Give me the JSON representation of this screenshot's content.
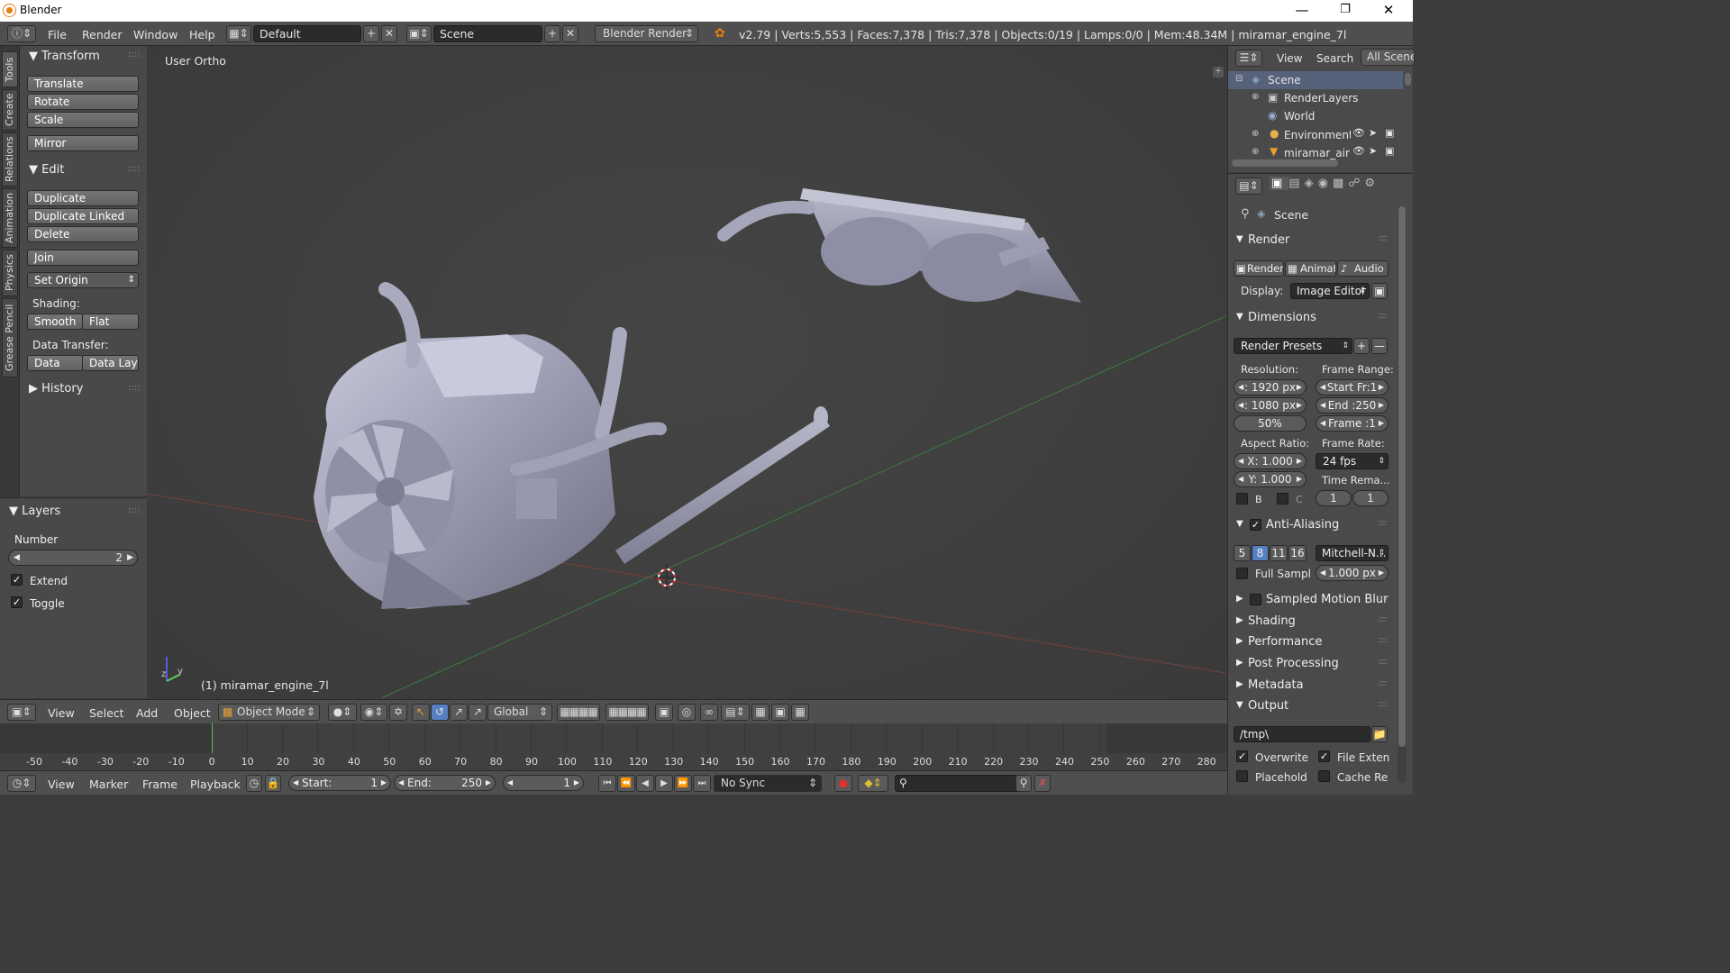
{
  "window": {
    "title": "Blender"
  },
  "info_bar": {
    "menus": [
      "File",
      "Render",
      "Window",
      "Help"
    ],
    "layout": "Default",
    "scene": "Scene",
    "engine": "Blender Render",
    "stats": "v2.79 | Verts:5,553 | Faces:7,378 | Tris:7,378 | Objects:0/19 | Lamps:0/0 | Mem:48.34M | miramar_engine_7l"
  },
  "tool_tabs": [
    "Tools",
    "Create",
    "Relations",
    "Animation",
    "Physics",
    "Grease Pencil"
  ],
  "tools": {
    "transform_header": "Transform",
    "translate": "Translate",
    "rotate": "Rotate",
    "scale": "Scale",
    "mirror": "Mirror",
    "edit_header": "Edit",
    "duplicate": "Duplicate",
    "duplicate_linked": "Duplicate Linked",
    "delete": "Delete",
    "join": "Join",
    "set_origin": "Set Origin",
    "shading_label": "Shading:",
    "smooth": "Smooth",
    "flat": "Flat",
    "data_transfer_label": "Data Transfer:",
    "data": "Data",
    "data_lay": "Data Lay",
    "history_header": "History"
  },
  "layers_panel": {
    "header": "Layers",
    "number_label": "Number",
    "number_value": "2",
    "extend": "Extend",
    "toggle": "Toggle"
  },
  "viewport": {
    "view_name": "User Ortho",
    "object_label": "(1) miramar_engine_7l"
  },
  "outliner": {
    "view": "View",
    "search": "Search",
    "filter": "All Scenes",
    "items": [
      "Scene",
      "RenderLayers",
      "World",
      "Environment",
      "miramar_air"
    ]
  },
  "properties": {
    "context": "Scene",
    "render_header": "Render",
    "render_btn": "Render",
    "anim_btn": "Animati",
    "audio_btn": "Audio",
    "display_label": "Display:",
    "display_value": "Image Editor",
    "dimensions_header": "Dimensions",
    "render_presets": "Render Presets",
    "resolution_label": "Resolution:",
    "frame_range_label": "Frame Range:",
    "res_x": ": 1920 px",
    "res_y": ": 1080 px",
    "res_pct": "50%",
    "start_fr": "Start Fr:1",
    "end_fr": "End :250",
    "frame": "Frame :1",
    "aspect_label": "Aspect Ratio:",
    "frame_rate_label": "Frame Rate:",
    "aspect_x": "X:  1.000",
    "aspect_y": "Y:  1.000",
    "fps": "24 fps",
    "time_remap": "Time Rema...",
    "b_label": "B",
    "c_label": "C",
    "remap_old": "1",
    "remap_new": "1",
    "aa_header": "Anti-Aliasing",
    "aa_samples": [
      "5",
      "8",
      "11",
      "16"
    ],
    "aa_filter": "Mitchell-N...",
    "full_sample": "Full Sampl",
    "filter_size": "1.000 px",
    "motion_blur": "Sampled Motion Blur",
    "shading": "Shading",
    "performance": "Performance",
    "post_processing": "Post Processing",
    "metadata": "Metadata",
    "output_header": "Output",
    "output_path": "/tmp\\",
    "overwrite": "Overwrite",
    "file_ext": "File Exten",
    "placeholder": "Placehold",
    "cache": "Cache Re"
  },
  "view3d_header": {
    "view": "View",
    "select": "Select",
    "add": "Add",
    "object": "Object",
    "mode": "Object Mode",
    "orientation": "Global"
  },
  "timeline": {
    "ticks": [
      "-50",
      "-40",
      "-30",
      "-20",
      "-10",
      "0",
      "10",
      "20",
      "30",
      "40",
      "50",
      "60",
      "70",
      "80",
      "90",
      "100",
      "110",
      "120",
      "130",
      "140",
      "150",
      "160",
      "170",
      "180",
      "190",
      "200",
      "210",
      "220",
      "230",
      "240",
      "250",
      "260",
      "270",
      "280"
    ],
    "view": "View",
    "marker": "Marker",
    "frame": "Frame",
    "playback": "Playback",
    "start": "Start:",
    "start_val": "1",
    "end": "End:",
    "end_val": "250",
    "current": "1",
    "sync": "No Sync"
  },
  "colors": {
    "accent": "#5680c2",
    "header": "#4f4f4f",
    "panel": "#494949",
    "viewport": "#3d3d3d"
  }
}
